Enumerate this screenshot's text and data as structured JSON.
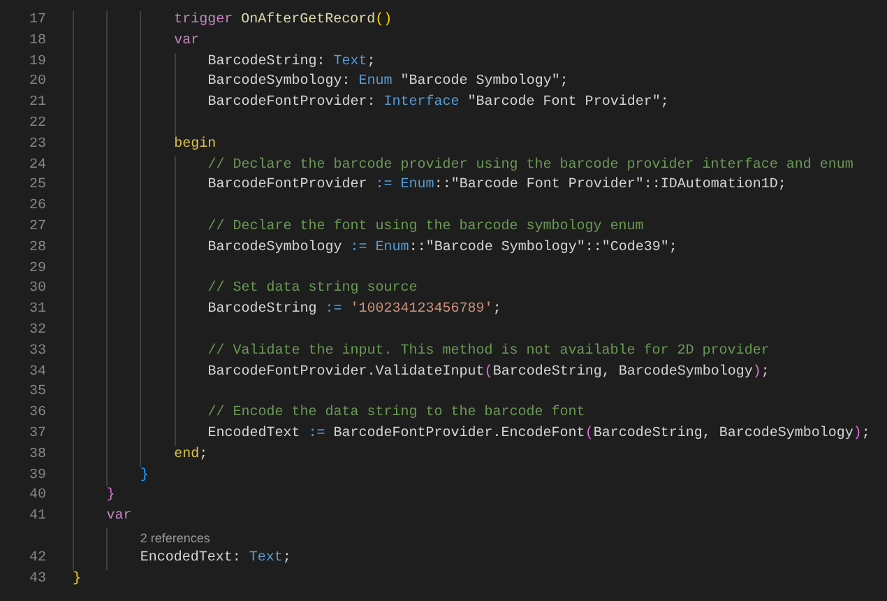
{
  "editor": {
    "lines": [
      {
        "kind": "block",
        "children": [
          {
            "kind": "block",
            "children": [
              {
                "kind": "block",
                "children": [
                  {
                    "kind": "line",
                    "number": "17",
                    "tokens": [
                      {
                        "kind": "keyword",
                        "text": "trigger"
                      },
                      {
                        "kind": "function",
                        "text": " OnAfterGetRecord"
                      },
                      {
                        "kind": "bracket1",
                        "text": "()"
                      }
                    ]
                  },
                  {
                    "kind": "line",
                    "number": "18",
                    "tokens": [
                      {
                        "kind": "keyword",
                        "text": "var"
                      }
                    ]
                  },
                  {
                    "kind": "block",
                    "children": [
                      {
                        "kind": "line",
                        "number": "19",
                        "tokens": [
                          {
                            "kind": "plain",
                            "text": "BarcodeString: "
                          },
                          {
                            "kind": "type",
                            "text": "Text"
                          },
                          {
                            "kind": "plain",
                            "text": ";"
                          }
                        ]
                      },
                      {
                        "kind": "line",
                        "number": "20",
                        "tokens": [
                          {
                            "kind": "plain",
                            "text": "BarcodeSymbology: "
                          },
                          {
                            "kind": "type",
                            "text": "Enum"
                          },
                          {
                            "kind": "plain",
                            "text": " \"Barcode Symbology\";"
                          }
                        ]
                      },
                      {
                        "kind": "line",
                        "number": "21",
                        "tokens": [
                          {
                            "kind": "plain",
                            "text": "BarcodeFontProvider: "
                          },
                          {
                            "kind": "type",
                            "text": "Interface"
                          },
                          {
                            "kind": "plain",
                            "text": " \"Barcode Font Provider\";"
                          }
                        ]
                      },
                      {
                        "kind": "line",
                        "number": "22"
                      }
                    ]
                  },
                  {
                    "kind": "line",
                    "number": "23",
                    "tokens": [
                      {
                        "kind": "control",
                        "text": "begin"
                      }
                    ]
                  },
                  {
                    "kind": "block",
                    "children": [
                      {
                        "kind": "line",
                        "number": "24",
                        "tokens": [
                          {
                            "kind": "comment",
                            "text": "// Declare the barcode provider using the barcode provider interface and enum"
                          }
                        ]
                      },
                      {
                        "kind": "line",
                        "number": "25",
                        "tokens": [
                          {
                            "kind": "plain",
                            "text": "BarcodeFontProvider "
                          },
                          {
                            "kind": "operator",
                            "text": ":= "
                          },
                          {
                            "kind": "type",
                            "text": "Enum"
                          },
                          {
                            "kind": "plain",
                            "text": "::\"Barcode Font Provider\"::IDAutomation1D;"
                          }
                        ]
                      },
                      {
                        "kind": "line",
                        "number": "26"
                      },
                      {
                        "kind": "line",
                        "number": "27",
                        "tokens": [
                          {
                            "kind": "comment",
                            "text": "// Declare the font using the barcode symbology enum"
                          }
                        ]
                      },
                      {
                        "kind": "line",
                        "number": "28",
                        "tokens": [
                          {
                            "kind": "plain",
                            "text": "BarcodeSymbology "
                          },
                          {
                            "kind": "operator",
                            "text": ":= "
                          },
                          {
                            "kind": "type",
                            "text": "Enum"
                          },
                          {
                            "kind": "plain",
                            "text": "::\"Barcode Symbology\"::\"Code39\";"
                          }
                        ]
                      },
                      {
                        "kind": "line",
                        "number": "29"
                      },
                      {
                        "kind": "line",
                        "number": "30",
                        "tokens": [
                          {
                            "kind": "comment",
                            "text": "// Set data string source"
                          }
                        ]
                      },
                      {
                        "kind": "line",
                        "number": "31",
                        "tokens": [
                          {
                            "kind": "plain",
                            "text": "BarcodeString "
                          },
                          {
                            "kind": "operator",
                            "text": ":= "
                          },
                          {
                            "kind": "string",
                            "text": "'100234123456789'"
                          },
                          {
                            "kind": "plain",
                            "text": ";"
                          }
                        ]
                      },
                      {
                        "kind": "line",
                        "number": "32"
                      },
                      {
                        "kind": "line",
                        "number": "33",
                        "tokens": [
                          {
                            "kind": "comment",
                            "text": "// Validate the input. This method is not available for 2D provider"
                          }
                        ]
                      },
                      {
                        "kind": "line",
                        "number": "34",
                        "tokens": [
                          {
                            "kind": "plain",
                            "text": "BarcodeFontProvider.ValidateInput"
                          },
                          {
                            "kind": "bracket2",
                            "text": "("
                          },
                          {
                            "kind": "plain",
                            "text": "BarcodeString, BarcodeSymbology"
                          },
                          {
                            "kind": "bracket2",
                            "text": ")"
                          },
                          {
                            "kind": "plain",
                            "text": ";"
                          }
                        ]
                      },
                      {
                        "kind": "line",
                        "number": "35"
                      },
                      {
                        "kind": "line",
                        "number": "36",
                        "tokens": [
                          {
                            "kind": "comment",
                            "text": "// Encode the data string to the barcode font"
                          }
                        ]
                      },
                      {
                        "kind": "line",
                        "number": "37",
                        "tokens": [
                          {
                            "kind": "plain",
                            "text": "EncodedText "
                          },
                          {
                            "kind": "operator",
                            "text": ":="
                          },
                          {
                            "kind": "plain",
                            "text": " BarcodeFontProvider.EncodeFont"
                          },
                          {
                            "kind": "bracket2",
                            "text": "("
                          },
                          {
                            "kind": "plain",
                            "text": "BarcodeString, BarcodeSymbology"
                          },
                          {
                            "kind": "bracket2",
                            "text": ")"
                          },
                          {
                            "kind": "plain",
                            "text": ";"
                          }
                        ]
                      }
                    ]
                  },
                  {
                    "kind": "line",
                    "number": "38",
                    "tokens": [
                      {
                        "kind": "control",
                        "text": "end"
                      },
                      {
                        "kind": "plain",
                        "text": ";"
                      }
                    ]
                  }
                ]
              },
              {
                "kind": "line",
                "number": "39",
                "tokens": [
                  {
                    "kind": "bracket3",
                    "text": "}"
                  }
                ]
              }
            ]
          },
          {
            "kind": "line",
            "number": "40",
            "tokens": [
              {
                "kind": "bracket2",
                "text": "}"
              }
            ]
          },
          {
            "kind": "line",
            "number": "41",
            "tokens": [
              {
                "kind": "keyword",
                "text": "var"
              }
            ]
          },
          {
            "kind": "block",
            "children": [
              {
                "kind": "codelens",
                "text": "2 references"
              },
              {
                "kind": "line",
                "number": "42",
                "tokens": [
                  {
                    "kind": "plain",
                    "text": "EncodedText: "
                  },
                  {
                    "kind": "type",
                    "text": "Text"
                  },
                  {
                    "kind": "plain",
                    "text": ";"
                  }
                ]
              }
            ]
          }
        ]
      },
      {
        "kind": "line",
        "number": "43",
        "tokens": [
          {
            "kind": "bracket1",
            "text": "}"
          }
        ]
      }
    ]
  }
}
